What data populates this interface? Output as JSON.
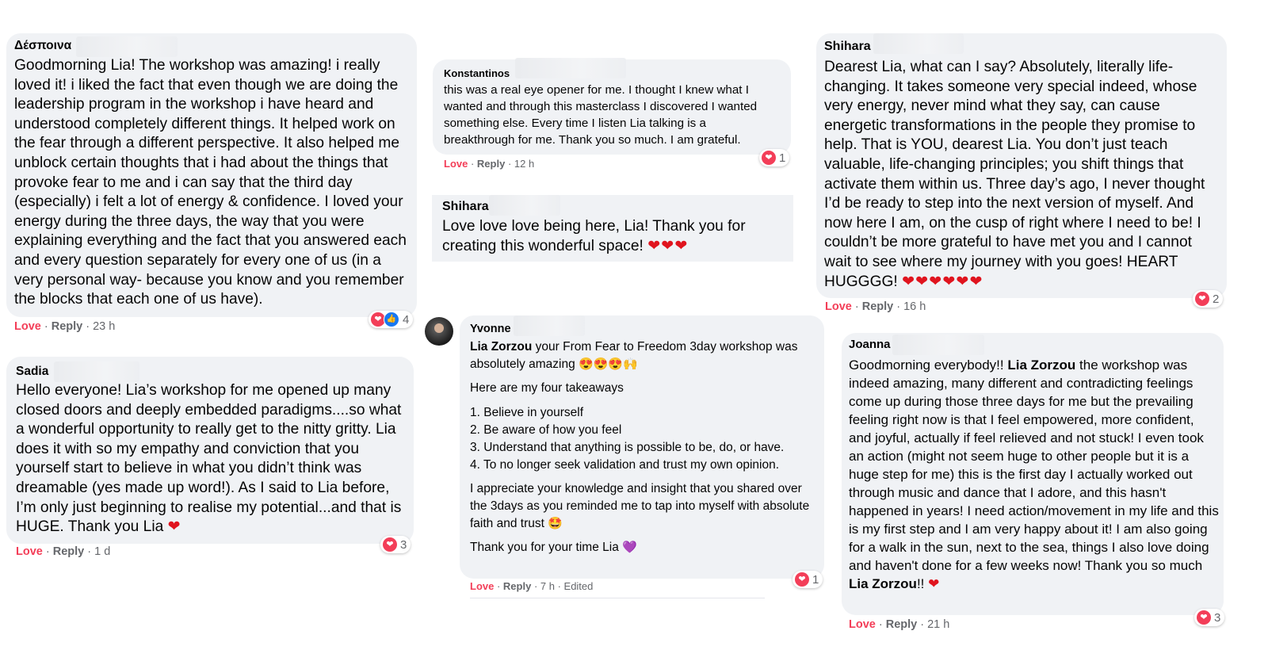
{
  "comments": {
    "despoina": {
      "author": "Δέσποινα",
      "text": "Goodmorning Lia! The workshop was amazing! i really loved it! i liked the fact that even though we are doing the leadership program in the workshop i have heard and understood completely different things. It helped work on the fear through a different perspective. It also helped me unblock certain thoughts that i had about the things that provoke fear to me and i can say that the third day (especially) i felt a lot of energy & confidence. I loved your energy during the three days, the way that you were explaining everything and the fact that you answered each and every question separately for every one of us (in a very personal way- because you know and you remember the blocks that each one of us have).",
      "love": "Love",
      "reply": "Reply",
      "time": "· 23 h",
      "reaction_count": "4"
    },
    "sadia": {
      "author": "Sadia",
      "text": "Hello everyone! Lia’s workshop for me opened up many closed doors and deeply embedded paradigms....so what a wonderful opportunity to really get to the nitty gritty. Lia does it with so my empathy and conviction that you yourself start to believe in what you didn’t think was dreamable (yes made up word!). As I said to Lia before, I’m only just beginning to realise my potential...and that is HUGE. Thank you Lia",
      "hearts": "❤",
      "love": "Love",
      "reply": "Reply",
      "time": "· 1 d",
      "reaction_count": "3"
    },
    "konstantinos": {
      "author": "Konstantinos",
      "text": "this was a real eye opener for me. I thought I knew what I wanted and through this masterclass I discovered I wanted something else. Every time I listen Lia talking is a breakthrough for me. Thank you so much. I am grateful.",
      "love": "Love",
      "reply": "Reply",
      "time": "· 12 h",
      "reaction_count": "1"
    },
    "shihara_small": {
      "author": "Shihara",
      "text": "Love love love being here, Lia! Thank you for creating this wonderful space!",
      "hearts": "❤❤❤"
    },
    "yvonne": {
      "author": "Yvonne",
      "mention": "Lia Zorzou",
      "line1": " your From Fear to Freedom 3day workshop was absolutely amazing",
      "emoji1": "😍😍😍🙌",
      "takeaways_intro": "Here are my four takeaways",
      "takeaways": [
        "1. Believe in yourself",
        "2. Be aware of how you feel",
        "3. Understand that anything is possible to be, do, or have.",
        "4. To no longer seek validation and trust my own opinion."
      ],
      "para2": "I appreciate your knowledge and insight that you shared over the 3days as you reminded me to tap into myself with absolute faith and trust",
      "emoji2": "🤩",
      "para3": "Thank you for your time Lia",
      "emoji3": "💜",
      "love": "Love",
      "reply": "Reply",
      "time": "· 7 h · Edited",
      "reaction_count": "1"
    },
    "shihara_big": {
      "author": "Shihara",
      "text": "Dearest Lia, what can I say? Absolutely, literally life-changing. It takes someone very special indeed, whose very energy, never mind what they say, can cause energetic transformations in the people they promise to help. That is YOU, dearest Lia. You don’t just teach valuable, life-changing principles; you shift things that activate them within us. Three day’s ago, I never thought I’d be ready to step into the next version of myself. And now here I am, on the cusp of right where I need to be! I couldn’t be more grateful to have met you and I cannot wait to see where my journey with you goes! HEART HUGGGG!",
      "hearts": "❤❤❤❤❤❤",
      "love": "Love",
      "reply": "Reply",
      "time": "· 16 h",
      "reaction_count": "2"
    },
    "joanna": {
      "author": "Joanna",
      "text_a": "Goodmorning everybody!! ",
      "mention": "Lia Zorzou",
      "text_b": " the workshop was indeed amazing, many different and contradicting feelings come up during those three days for me but the prevailing feeling right now is that I feel empowered, more confident, and joyful, actually if feel relieved and not stuck! I even took an action (might not seem huge to other people but it is a huge step for me) this is the first day I actually worked out through music and dance that I adore, and this hasn't happened in years! I need action/movement in my life and this is my first step and I am very happy about it! I am also going for a walk in the sun, next to the sea, things I also love doing and haven't done for a few weeks now! Thank you so much ",
      "mention2": "Lia Zorzou",
      "text_c": "!! ",
      "hearts": "❤",
      "love": "Love",
      "reply": "Reply",
      "time": "· 21 h",
      "reaction_count": "3"
    }
  },
  "icons": {
    "heart_reaction": "heart-reaction-icon",
    "like_reaction": "like-reaction-icon"
  },
  "colors": {
    "bubble": "#f0f2f5",
    "love": "#f33e58",
    "meta": "#65676b",
    "like": "#1877f2"
  }
}
